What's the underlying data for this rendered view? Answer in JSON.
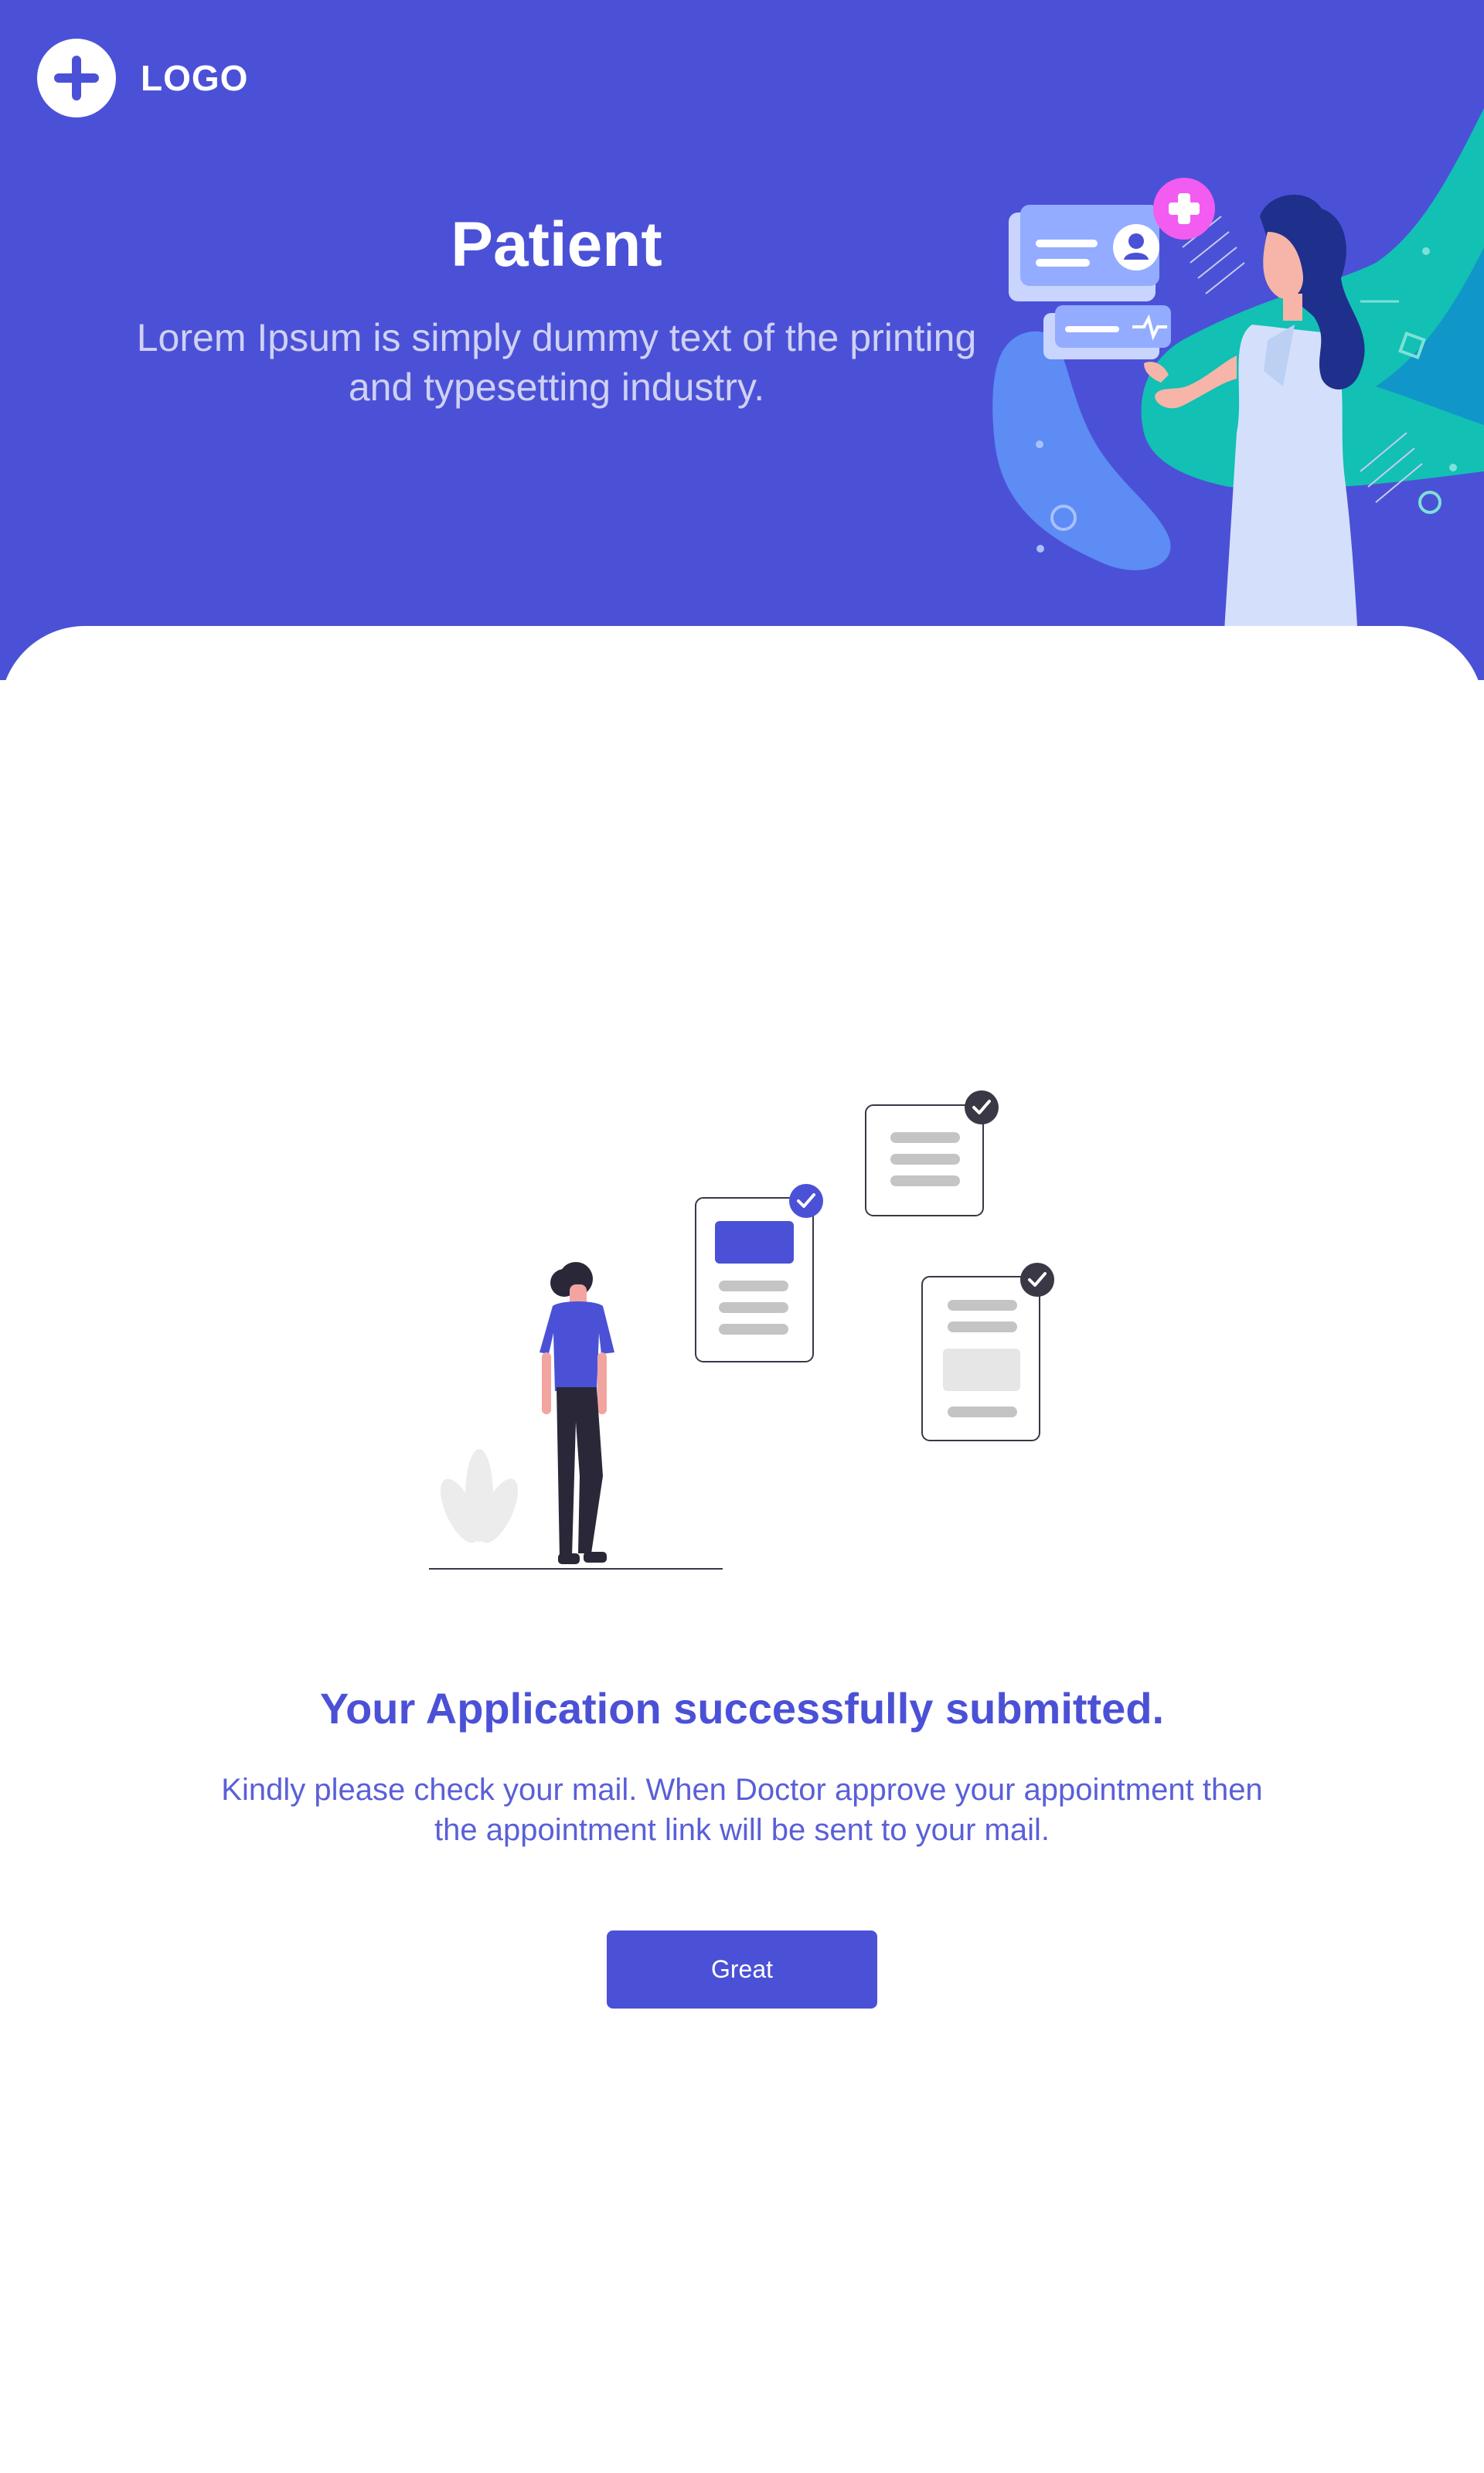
{
  "header": {
    "logo_text": "LOGO",
    "title": "Patient",
    "subtitle": "Lorem Ipsum is simply dummy text of the printing and typesetting industry."
  },
  "confirmation": {
    "title": "Your Application successfully submitted.",
    "message": "Kindly please check your mail. When Doctor approve your appointment then the appointment link will be sent to your mail.",
    "button_label": "Great"
  },
  "icons": {
    "logo": "plus-circle-icon",
    "check": "check-badge-icon"
  },
  "colors": {
    "primary": "#4b51d6",
    "accent_teal": "#12c0b4",
    "accent_pink": "#f25cf0",
    "text_on_primary": "#ffffff",
    "subtitle_on_primary": "#cfd1f3",
    "dark": "#3a3845"
  }
}
